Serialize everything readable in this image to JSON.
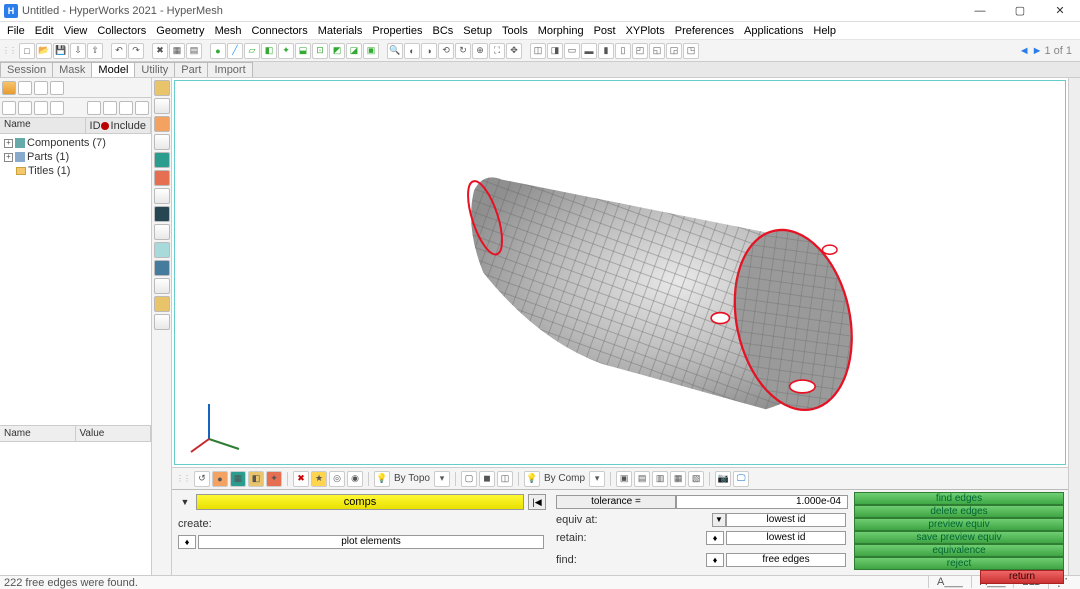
{
  "window": {
    "app_icon_letter": "H",
    "title": "Untitled - HyperWorks 2021 - HyperMesh",
    "min": "—",
    "max": "▢",
    "close": "✕"
  },
  "menu": [
    "File",
    "Edit",
    "View",
    "Collectors",
    "Geometry",
    "Mesh",
    "Connectors",
    "Materials",
    "Properties",
    "BCs",
    "Setup",
    "Tools",
    "Morphing",
    "Post",
    "XYPlots",
    "Preferences",
    "Applications",
    "Help"
  ],
  "top_page": {
    "label": "1 of 1",
    "prev": "◄",
    "next": "►"
  },
  "left_tabs": [
    "Session",
    "Mask",
    "Model",
    "Utility",
    "Part",
    "Import"
  ],
  "tree_header": {
    "name": "Name",
    "id": "ID",
    "include": "Include"
  },
  "tree": [
    {
      "label": "Components (7)",
      "expandable": true
    },
    {
      "label": "Parts (1)",
      "expandable": true
    },
    {
      "label": "Titles (1)",
      "expandable": false
    }
  ],
  "props_header": {
    "name": "Name",
    "value": "Value"
  },
  "view_toolbar": {
    "by_topo": "By Topo",
    "by_comp": "By Comp"
  },
  "panel": {
    "comps": "comps",
    "create_label": "create:",
    "plot_elements": "plot elements",
    "tolerance_label": "tolerance =",
    "tolerance_value": "1.000e-04",
    "equiv_at": "equiv at:",
    "retain": "retain:",
    "find": "find:",
    "lowest_id": "lowest id",
    "free_edges": "free edges",
    "spin_glyph": "♦",
    "dd_glyph": "▼",
    "rewind_glyph": "|◀",
    "tri_glyph": "▼"
  },
  "buttons": {
    "find_edges": "find edges",
    "delete_edges": "delete edges",
    "preview_equiv": "preview equiv",
    "save_preview_equiv": "save preview equiv",
    "equivalence": "equivalence",
    "reject": "reject",
    "return": "return"
  },
  "status": {
    "message": "222 free edges were found.",
    "seg1": "A___",
    "seg2": "A___",
    "seg3": "211"
  }
}
